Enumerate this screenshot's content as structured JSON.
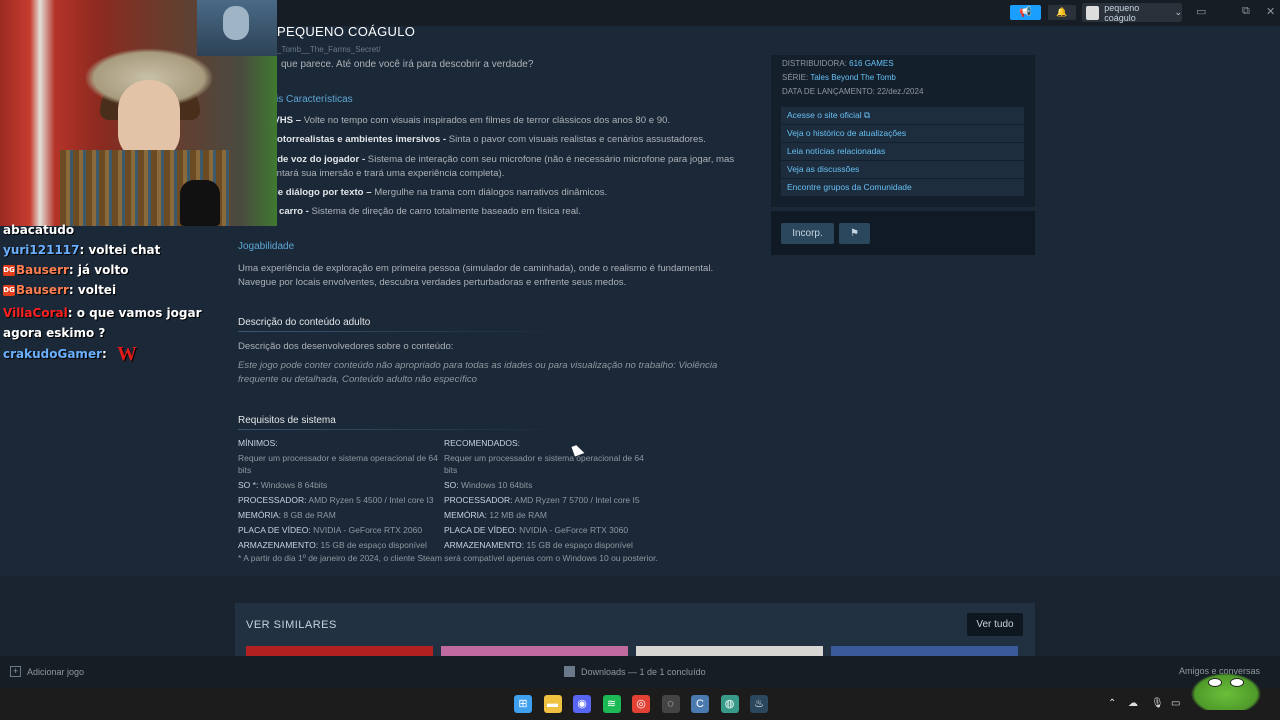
{
  "header": {
    "title": "PEQUENO COÁGULO",
    "breadcrumb": "_Tomb__The_Farms_Secret/",
    "user_name": "pequeno coágulo",
    "window_controls": [
      "▭",
      "⧉",
      "✕"
    ]
  },
  "chat": [
    {
      "user": "abacatudo",
      "user_color": "#ffffff",
      "message": ""
    },
    {
      "user": "yuri121117",
      "user_color": "#6ab0ff",
      "message": "voltei chat"
    },
    {
      "user": "Bauserr",
      "user_color": "#ff7f50",
      "badge": "DG",
      "message": "já volto"
    },
    {
      "user": "Bauserr",
      "user_color": "#ff7f50",
      "badge": "DG",
      "message": "voltei"
    },
    {
      "user": "VillaCoral",
      "user_color": "#ff2020",
      "message": "o que vamos jogar agora eskimo ?"
    },
    {
      "user": "crakudoGamer",
      "user_color": "#6ab0ff",
      "message": "",
      "emote": "W"
    }
  ],
  "description": {
    "top_line": "que parece. Até onde você irá para descobrir a verdade?",
    "features_heading": "is Características",
    "features": [
      {
        "bold": "ca VHS –",
        "text": " Volte no tempo com visuais inspirados em filmes de terror clássicos dos anos 80 e 90."
      },
      {
        "bold": "os fotorrealistas e ambientes imersivos -",
        "text": " Sinta o pavor com visuais realistas e cenários assustadores."
      },
      {
        "bold": "ade de voz do jogador -",
        "text": " Sistema de interação com seu microfone (não é necessário microfone para jogar, mas"
      },
      {
        "bold": "",
        "text": "umentará sua imersão e trará uma experiência completa)."
      },
      {
        "bold": "na de diálogo por texto –",
        "text": " Mergulhe na trama com diálogos narrativos dinâmicos."
      },
      {
        "bold": "carro -",
        "text": " Sistema de direção de carro totalmente baseado em física real."
      }
    ],
    "gameplay_heading": "Jogabilidade",
    "gameplay_text_1": "Uma experiência de exploração em primeira pessoa (simulador de caminhada), onde o realismo é fundamental.",
    "gameplay_text_2": "Navegue por locais envolventes, descubra verdades perturbadoras e enfrente seus medos."
  },
  "adult": {
    "heading": "Descrição do conteúdo adulto",
    "intro": "Descrição dos desenvolvedores sobre o conteúdo:",
    "text_1": "Este jogo pode conter conteúdo não apropriado para todas as idades ou para visualização no trabalho: Violência",
    "text_2": "frequente ou detalhada, Conteúdo adulto não específico"
  },
  "requirements": {
    "heading": "Requisitos de sistema",
    "minimum": {
      "title": "MÍNIMOS:",
      "intro_1": "Requer um processador e sistema operacional de 64",
      "intro_2": "bits",
      "os_label": "SO *:",
      "os": "Windows 8 64bits",
      "cpu_label": "PROCESSADOR:",
      "cpu": "AMD Ryzen 5 4500 / Intel core I3",
      "ram_label": "MEMÓRIA:",
      "ram": "8 GB de RAM",
      "gpu_label": "PLACA DE VÍDEO:",
      "gpu": "NVIDIA - GeForce RTX 2060",
      "storage_label": "ARMAZENAMENTO:",
      "storage": "15 GB de espaço disponível"
    },
    "recommended": {
      "title": "RECOMENDADOS:",
      "intro_1": "Requer um processador e sistema operacional de 64",
      "intro_2": "bits",
      "os_label": "SO:",
      "os": "Windows 10 64bits",
      "cpu_label": "PROCESSADOR:",
      "cpu": "AMD Ryzen 7 5700 / Intel core I5",
      "ram_label": "MEMÓRIA:",
      "ram": "12 MB de RAM",
      "gpu_label": "PLACA DE VÍDEO:",
      "gpu": "NVIDIA - GeForce RTX 3060",
      "storage_label": "ARMAZENAMENTO:",
      "storage": "15 GB de espaço disponível"
    },
    "note": "*  A partir do dia 1º de janeiro de 2024, o cliente Steam será compatível apenas com o Windows 10 ou posterior."
  },
  "sidebar": {
    "publisher_label": "DISTRIBUIDORA:",
    "publisher": "616 GAMES",
    "series_label": "SÉRIE:",
    "series": "Tales Beyond The Tomb",
    "release_label": "DATA DE LANÇAMENTO:",
    "release": "22/dez./2024",
    "links": [
      "Acesse o site oficial ⧉",
      "Veja o histórico de atualizações",
      "Leia notícias relacionadas",
      "Veja as discussões",
      "Encontre grupos da Comunidade"
    ],
    "embed_label": "Incorp.",
    "flag_icon": "⚑"
  },
  "similar": {
    "title": "VER SIMILARES",
    "see_all": "Ver tudo",
    "thumb_colors": [
      "#b32020",
      "#c06aa0",
      "#d8d6d2",
      "#3a5a9a"
    ]
  },
  "bottombar": {
    "add_game": "Adicionar jogo",
    "downloads": "Downloads — 1 de 1 concluído",
    "friends": "Amigos e conversas"
  },
  "taskbar": {
    "icons": [
      {
        "name": "windows-start-icon",
        "glyph": "⊞",
        "color": "#3fa0f0"
      },
      {
        "name": "file-explorer-icon",
        "glyph": "▬",
        "color": "#f0c040"
      },
      {
        "name": "discord-icon",
        "glyph": "◉",
        "color": "#5865f2"
      },
      {
        "name": "spotify-icon",
        "glyph": "≋",
        "color": "#1db954"
      },
      {
        "name": "chrome-icon",
        "glyph": "◎",
        "color": "#e34133"
      },
      {
        "name": "obs-icon",
        "glyph": "◌",
        "color": "#444"
      },
      {
        "name": "ccleaner-icon",
        "glyph": "C",
        "color": "#4a7ab0"
      },
      {
        "name": "globe-icon",
        "glyph": "◍",
        "color": "#3a9a8a"
      },
      {
        "name": "steam-icon",
        "glyph": "♨",
        "color": "#2a475e"
      }
    ]
  },
  "colors": {
    "accent": "#66c0f4",
    "section_heading": "#5ea7d6",
    "background": "#1b2838",
    "announce": "#1a9fff"
  }
}
